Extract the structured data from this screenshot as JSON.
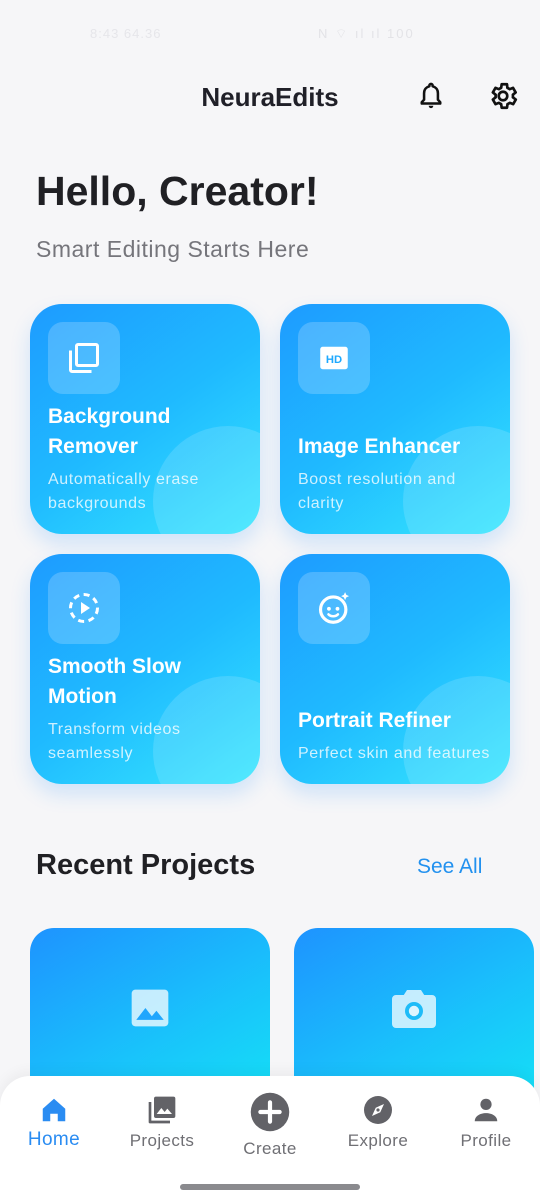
{
  "status": {
    "time": "8:43 64.36",
    "icons_text": "N ⌔ ıl ıl 100"
  },
  "header": {
    "title": "NeuraEdits",
    "bell_icon": "bell-icon",
    "settings_icon": "gear-icon"
  },
  "hero": {
    "greeting": "Hello, Creator!",
    "tagline": "Smart Editing Starts Here"
  },
  "tools": [
    {
      "title": "Background Remover",
      "desc": "Automatically erase backgrounds",
      "icon": "layers-icon"
    },
    {
      "title": "Image Enhancer",
      "desc": "Boost resolution and clarity",
      "icon": "hd-icon"
    },
    {
      "title": "Smooth Slow Motion",
      "desc": "Transform videos seamlessly",
      "icon": "slow-motion-icon"
    },
    {
      "title": "Portrait Refiner",
      "desc": "Perfect skin and features",
      "icon": "face-retouch-icon"
    }
  ],
  "recent": {
    "title": "Recent Projects",
    "see_all": "See All",
    "items": [
      {
        "icon": "image-icon"
      },
      {
        "icon": "camera-icon"
      }
    ]
  },
  "nav": {
    "items": [
      {
        "label": "Home",
        "icon": "home-icon",
        "active": true
      },
      {
        "label": "Projects",
        "icon": "photo-library-icon"
      },
      {
        "label": "Create",
        "icon": "add-circle-icon"
      },
      {
        "label": "Explore",
        "icon": "compass-icon"
      },
      {
        "label": "Profile",
        "icon": "person-icon"
      }
    ]
  },
  "colors": {
    "accent": "#2291ef",
    "card_gradient_start": "#1e9bff",
    "card_gradient_end": "#36e6fe",
    "background": "#f6f6f8"
  }
}
